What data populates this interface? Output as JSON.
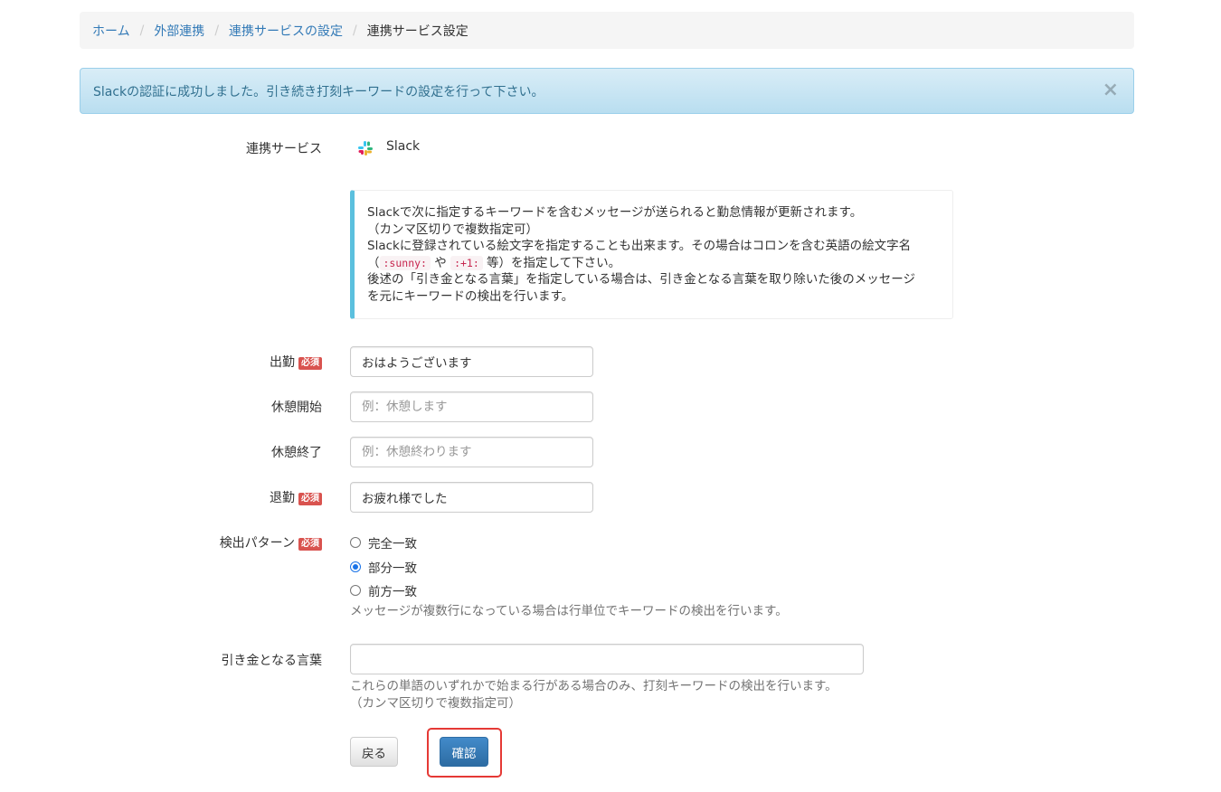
{
  "breadcrumb": {
    "items": [
      "ホーム",
      "外部連携",
      "連携サービスの設定"
    ],
    "separator": "/",
    "current": "連携サービス設定"
  },
  "alert": {
    "message": "Slackの認証に成功しました。引き続き打刻キーワードの設定を行って下さい。",
    "close": "×"
  },
  "service": {
    "label": "連携サービス",
    "name": "Slack",
    "icon": "slack-logo-icon"
  },
  "info": {
    "line1": "Slackで次に指定するキーワードを含むメッセージが送られると勤怠情報が更新されます。",
    "line2": "（カンマ区切りで複数指定可）",
    "line3": "Slackに登録されている絵文字を指定することも出来ます。その場合はコロンを含む英語の絵文字名",
    "line4_pre": "（",
    "code1": ":sunny:",
    "line4_mid": " や ",
    "code2": ":+1:",
    "line4_post": " 等）を指定して下さい。",
    "line5": "後述の「引き金となる言葉」を指定している場合は、引き金となる言葉を取り除いた後のメッセージ",
    "line6": "を元にキーワードの検出を行います。"
  },
  "required_badge": "必須",
  "fields": {
    "clock_in": {
      "label": "出勤",
      "value": "おはようございます",
      "placeholder": ""
    },
    "break_start": {
      "label": "休憩開始",
      "value": "",
      "placeholder": "例：休憩します"
    },
    "break_end": {
      "label": "休憩終了",
      "value": "",
      "placeholder": "例：休憩終わります"
    },
    "clock_out": {
      "label": "退勤",
      "value": "お疲れ様でした",
      "placeholder": ""
    }
  },
  "detection": {
    "label": "検出パターン",
    "options": [
      "完全一致",
      "部分一致",
      "前方一致"
    ],
    "selected": "部分一致",
    "help": "メッセージが複数行になっている場合は行単位でキーワードの検出を行います。"
  },
  "trigger": {
    "label": "引き金となる言葉",
    "value": "",
    "help1": "これらの単語のいずれかで始まる行がある場合のみ、打刻キーワードの検出を行います。",
    "help2": "（カンマ区切りで複数指定可）"
  },
  "buttons": {
    "back": "戻る",
    "confirm": "確認"
  },
  "colors": {
    "link": "#337ab7",
    "alert_bg": "#d9edf7",
    "callout_border": "#5bc0de",
    "required": "#d9534f",
    "primary": "#337ab7",
    "highlight": "#e53935"
  }
}
